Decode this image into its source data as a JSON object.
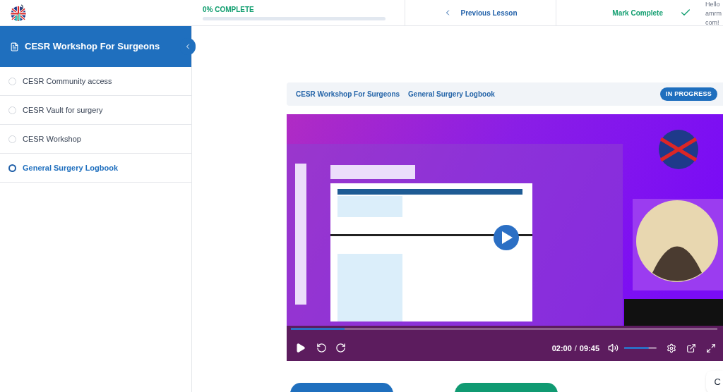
{
  "header": {
    "progress": {
      "label": "0% COMPLETE",
      "level": 0
    },
    "previous_lesson": "Previous Lesson",
    "mark_complete": "Mark Complete",
    "greeting": [
      "Hello",
      "amrm",
      "com!"
    ]
  },
  "sidebar": {
    "course_title": "CESR Workshop For Surgeons",
    "lessons": [
      {
        "title": "CESR Community access",
        "selected": false
      },
      {
        "title": "CESR Vault for surgery",
        "selected": false
      },
      {
        "title": "CESR Workshop",
        "selected": false
      },
      {
        "title": "General Surgery Logbook",
        "selected": true
      }
    ]
  },
  "breadcrumb": [
    "CESR Workshop For Surgeons",
    "General Surgery Logbook"
  ],
  "status_badge": "IN PROGRESS",
  "video": {
    "kind": "picture",
    "playback": {
      "level": 0.125
    },
    "time_current": "02:00",
    "time_separator": "/",
    "time_total": "09:45",
    "volume": {
      "level": 0.75
    }
  },
  "corner_chip": "C"
}
